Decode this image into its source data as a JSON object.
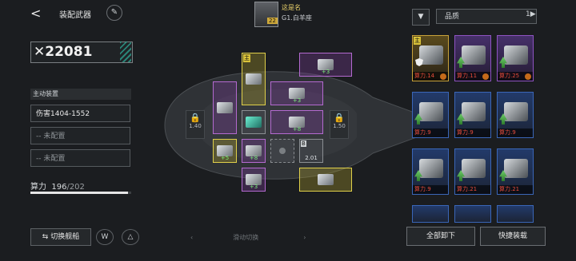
{
  "header": {
    "back": "<",
    "title": "装配武器",
    "edit_icon": "✎"
  },
  "player": {
    "name": "这是名",
    "level": "22",
    "galaxy": "G1.白羊座"
  },
  "power": {
    "icon": "✕",
    "value": "22081"
  },
  "active": {
    "heading": "主动装置",
    "slots": [
      "伤害1404-1552",
      "-- 未配置",
      "-- 未配置"
    ]
  },
  "capacity": {
    "label": "算力",
    "current": "196",
    "max": "/202",
    "fill": 0.97
  },
  "footer": {
    "switch_label": "切换舰船",
    "swipe_label": "滑动切换",
    "left_chev": "‹",
    "right_chev": "›"
  },
  "modules": {
    "main_tag": "主",
    "plus": "+3",
    "plus_b": "+5",
    "plus_c": "+8",
    "lock_left": "1.40",
    "lock_right": "1.50",
    "b_label": "B",
    "b_value": "2.01"
  },
  "right": {
    "sort_label": "品质",
    "sort_toggle": "1▶",
    "unload": "全部卸下",
    "quick": "快捷装载"
  },
  "cards": [
    {
      "cost": "算力.14",
      "eq": "主",
      "rarity": "gold"
    },
    {
      "cost": "算力.11",
      "eq": "",
      "rarity": "pur"
    },
    {
      "cost": "算力.25",
      "eq": "",
      "rarity": "pur"
    },
    {
      "cost": "算力.9",
      "eq": "",
      "rarity": "blue"
    },
    {
      "cost": "算力.9",
      "eq": "",
      "rarity": "blue"
    },
    {
      "cost": "算力.9",
      "eq": "",
      "rarity": "blue"
    },
    {
      "cost": "算力.9",
      "eq": "",
      "rarity": "blue"
    },
    {
      "cost": "算力.21",
      "eq": "",
      "rarity": "blue"
    },
    {
      "cost": "算力.21",
      "eq": "",
      "rarity": "blue"
    }
  ],
  "colors": {
    "accent": "#2fae9a",
    "gold": "#e0d04a",
    "purple": "#b46ad0",
    "cost_red": "#e94c3b",
    "plus_green": "#7df07d"
  }
}
